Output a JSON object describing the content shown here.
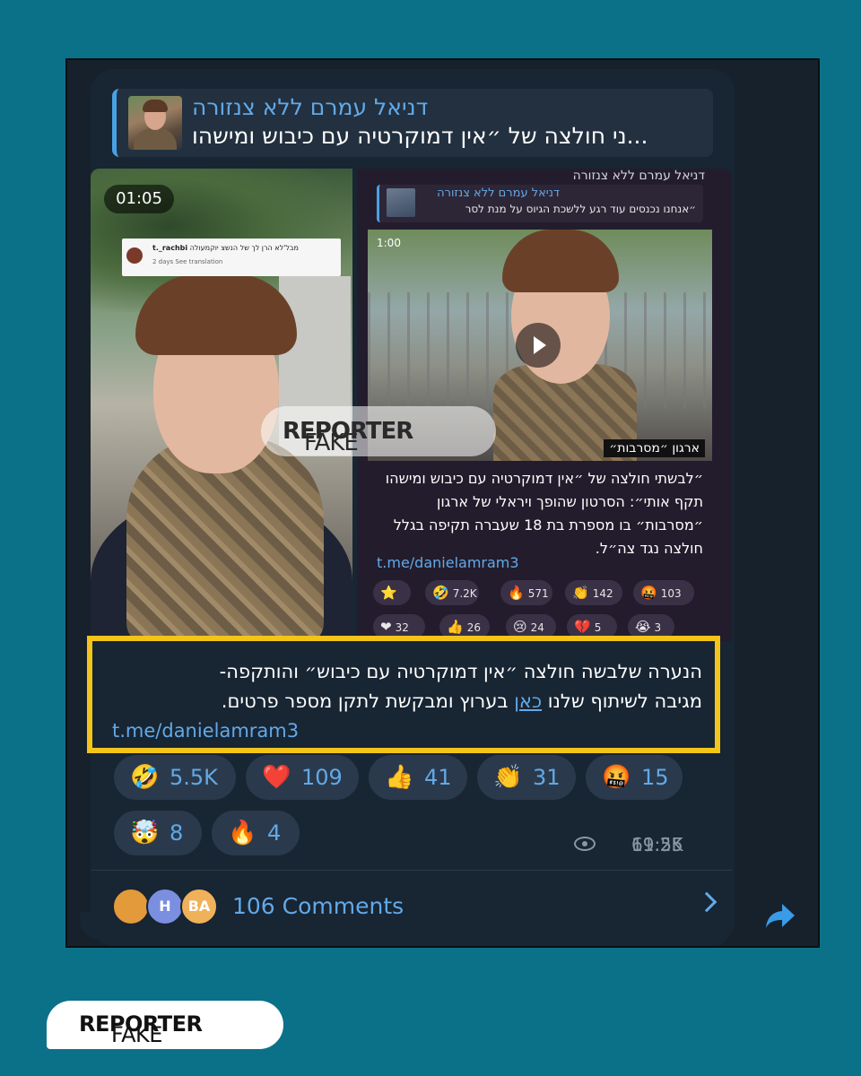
{
  "post": {
    "reply": {
      "author": "דניאל עמרם ללא צנזורה",
      "text": "ני חולצה של ״אין דמוקרטיה עם כיבוש ומישהו..."
    },
    "left_video": {
      "duration": "01:05",
      "comment_user": "t._rachbi",
      "comment_text": "מבל'לא הרן לך של הנשצ יוקמעולה",
      "comment_meta": "2 days   See translation"
    },
    "watermark": {
      "part1": "FAKE",
      "part2": "REPORTER"
    },
    "right_screenshot": {
      "channel": "דניאל עמרם ללא צנזורה",
      "reply_author": "דניאל עמרם ללא צנזורה",
      "reply_text": "״אנחנו נכנסים עוד רגע ללשכת הגיוס על מנת לסר",
      "video_time": "1:00",
      "video_label": "ארגון ״מסרבות״",
      "caption": "״לבשתי חולצה של ״אין דמוקרטיה עם כיבוש ומישהו תקף אותי״: הסרטון שהופך ויראלי של ארגון ״מסרבות״ בו מספרת בת 18 שעברה תקיפה בגלל חולצה נגד צה״ל.",
      "link": "t.me/danielamram3",
      "reactions": [
        {
          "icon": "⭐",
          "count": ""
        },
        {
          "icon": "🤣",
          "count": "7.2K"
        },
        {
          "icon": "🔥",
          "count": "571"
        },
        {
          "icon": "👏",
          "count": "142"
        },
        {
          "icon": "🤬",
          "count": "103"
        },
        {
          "icon": "❤",
          "count": "32"
        },
        {
          "icon": "👍",
          "count": "26"
        },
        {
          "icon": "😢",
          "count": "24"
        },
        {
          "icon": "💔",
          "count": "5"
        },
        {
          "icon": "😭",
          "count": "3"
        }
      ]
    },
    "message": {
      "line1": "הנערה שלבשה חולצה ״אין דמוקרטיה עם כיבוש״ והותקפה-",
      "line2_a": "מגיבה לשיתוף שלנו",
      "line2_link": "כאן",
      "line2_b": "בערוץ ומבקשת לתקן מספר פרטים.",
      "link": "t.me/danielamram3"
    },
    "reactions": [
      {
        "icon": "🤣",
        "count": "5.5K"
      },
      {
        "icon": "❤️",
        "count": "109"
      },
      {
        "icon": "👍",
        "count": "41"
      },
      {
        "icon": "👏",
        "count": "31"
      },
      {
        "icon": "🤬",
        "count": "15"
      },
      {
        "icon": "🤯",
        "count": "8"
      },
      {
        "icon": "🔥",
        "count": "4"
      }
    ],
    "views": "61.2K",
    "time": "19:55",
    "comments": {
      "avatars": [
        "",
        "H",
        "BA"
      ],
      "label": "106 Comments"
    }
  },
  "brand": {
    "part1": "FAKE",
    "part2": "REPORTER"
  },
  "colors": {
    "background": "#0b7189",
    "highlight": "#f3c41a",
    "link": "#62a9e8",
    "bubble": "#182533"
  }
}
